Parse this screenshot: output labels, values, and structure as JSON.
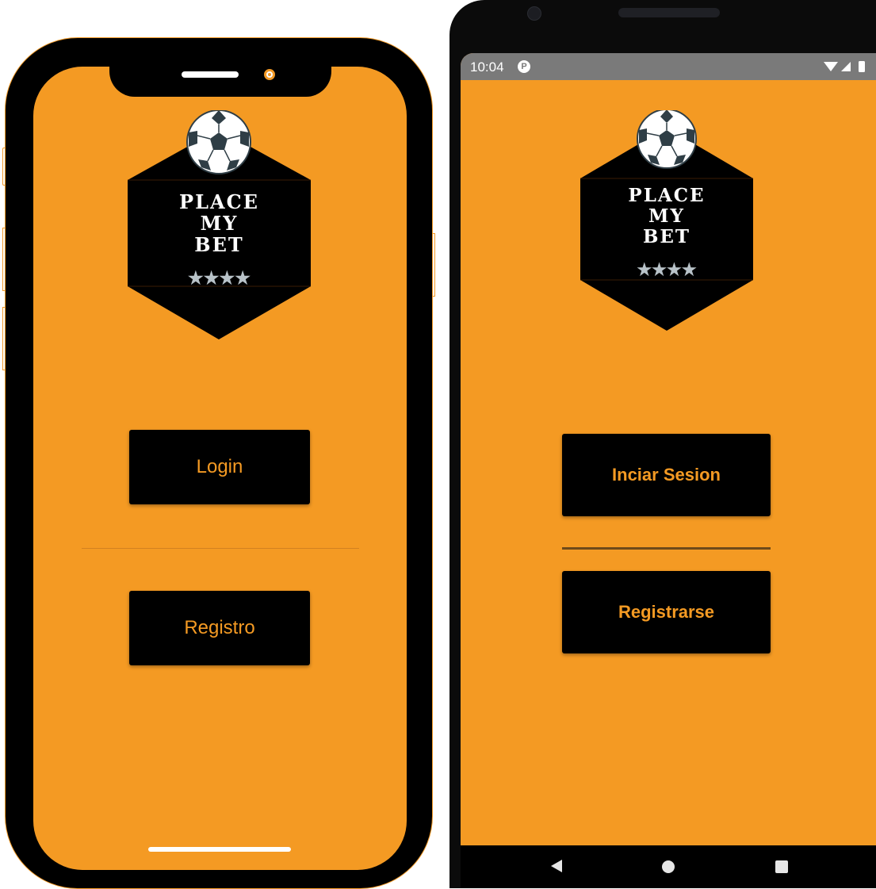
{
  "colors": {
    "background": "#f49a23",
    "button": "#000000",
    "button_text": "#f49a23",
    "status_bar": "#7a7a7a"
  },
  "logo": {
    "lines": [
      "PLACE",
      "MY",
      "BET"
    ],
    "stars": "★★★★",
    "ball_icon": "soccer-ball-icon"
  },
  "ios_screen": {
    "login_label": "Login",
    "register_label": "Registro"
  },
  "android_screen": {
    "status_time": "10:04",
    "login_label": "Inciar Sesion",
    "register_label": "Registrarse"
  }
}
